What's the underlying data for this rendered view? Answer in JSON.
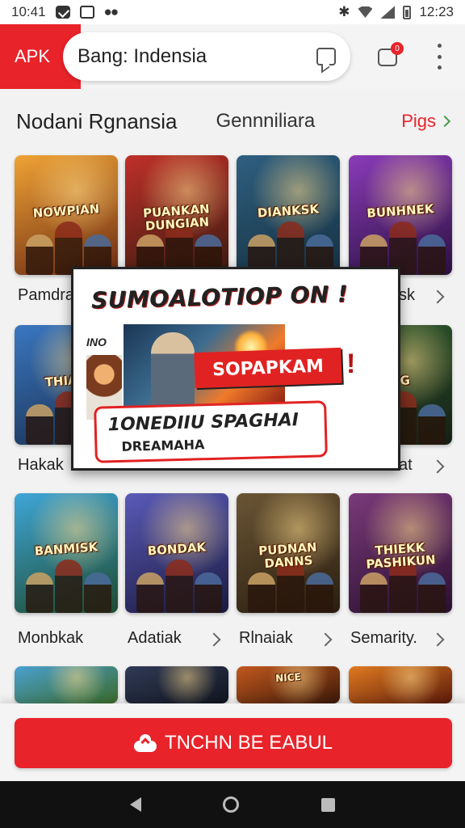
{
  "status_bar": {
    "left_time": "10:41",
    "right_time": "12:23",
    "icons": [
      "message-box-icon",
      "notification-icon",
      "screen-icon",
      "dots-icon",
      "bluetooth-icon",
      "wifi-icon",
      "signal-icon",
      "battery-icon"
    ]
  },
  "app_bar": {
    "apk_label": "APK",
    "search_value": "Bang: Indensia",
    "notification_count": "0",
    "accent_color": "#e8232a"
  },
  "section": {
    "title": "Nodani Rgnansia",
    "subtitle": "Gennniliara",
    "see_more": "Pigs"
  },
  "rows": [
    {
      "tiles": [
        {
          "title": "NOWPIAN",
          "colors": [
            "#f0a335",
            "#6b2a12"
          ]
        },
        {
          "title": "PUANKAN DUNGIAN",
          "colors": [
            "#c0302a",
            "#3a1a10"
          ]
        },
        {
          "title": "DIANKSK",
          "colors": [
            "#2f5f80",
            "#153040"
          ]
        },
        {
          "title": "BUNHNEK",
          "colors": [
            "#8a3bb8",
            "#2a1040"
          ]
        }
      ],
      "labels": [
        "Pamdra",
        "",
        "",
        "sk"
      ]
    },
    {
      "tiles": [
        {
          "title": "THIAN",
          "colors": [
            "#3a77c0",
            "#1a2f50"
          ]
        },
        {
          "title": "",
          "colors": [
            "#555",
            "#222"
          ]
        },
        {
          "title": "",
          "colors": [
            "#555",
            "#222"
          ]
        },
        {
          "title": "BG",
          "colors": [
            "#2e5a2e",
            "#151f15"
          ]
        }
      ],
      "labels": [
        "Hakak",
        "",
        "",
        "at"
      ]
    },
    {
      "tiles": [
        {
          "title": "BANMISK",
          "colors": [
            "#3fa6d8",
            "#1d4a2f"
          ]
        },
        {
          "title": "BONDAK",
          "colors": [
            "#5a5ab8",
            "#1a1a40"
          ]
        },
        {
          "title": "PUDNAN DANNS",
          "colors": [
            "#6a5535",
            "#2a1e10"
          ]
        },
        {
          "title": "THIEKK PASHIKUN",
          "colors": [
            "#7a3a7a",
            "#2a1030"
          ]
        }
      ],
      "labels": [
        "Monbkak",
        "Adatiak",
        "Rlnaiak",
        "Semarity."
      ]
    },
    {
      "tiles": [
        {
          "title": "",
          "colors": [
            "#4aa0d0",
            "#3a6a2a"
          ]
        },
        {
          "title": "",
          "colors": [
            "#303a55",
            "#101520"
          ]
        },
        {
          "title": "NICE",
          "colors": [
            "#c2581e",
            "#3a1808"
          ]
        },
        {
          "title": "",
          "colors": [
            "#e07a20",
            "#5a1a0a"
          ]
        }
      ],
      "labels": [
        "",
        "",
        "",
        ""
      ]
    }
  ],
  "promo": {
    "headline": "SUMOALOTIOP ON !",
    "side_label": "INO",
    "banner": "SOPAPKAM",
    "banner_bang": "!",
    "cta_line1": "1ONEDIIU SPAGHAI",
    "cta_line2": "DREAMAHA"
  },
  "install_button": {
    "label": "TNCHN BE EABUL"
  }
}
